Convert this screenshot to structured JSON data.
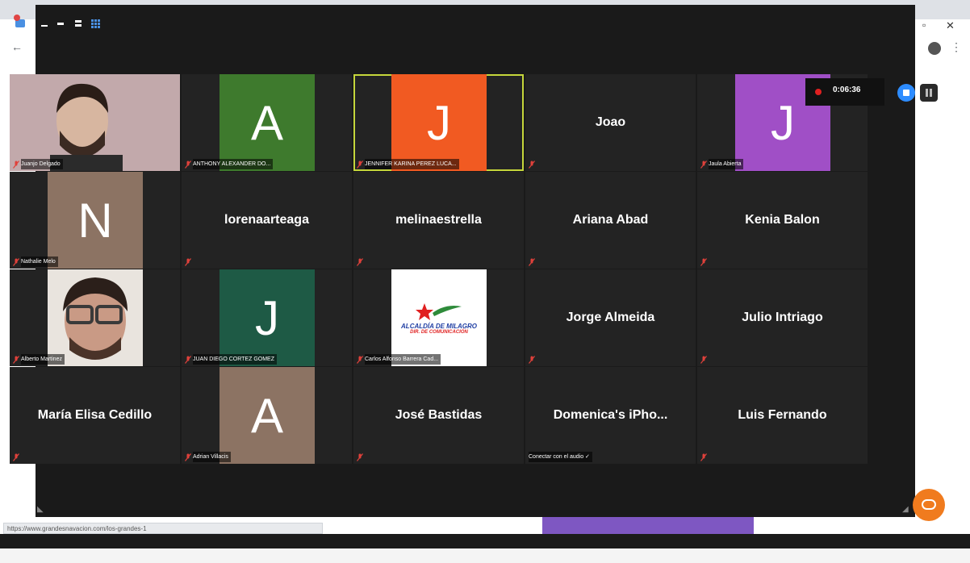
{
  "browser": {
    "back_glyph": "←",
    "menu_glyph": "⋮",
    "status_url": "https://www.grandesnavacion.com/los-grandes-1"
  },
  "window_controls": {
    "minimize": "▬",
    "restore": "▫",
    "close": "✕"
  },
  "toolbar": {
    "view_icons": [
      "minimize-icon",
      "minus-icon",
      "speaker-view-icon",
      "gallery-view-icon"
    ]
  },
  "recording": {
    "timer": "0:06:36"
  },
  "participants": [
    {
      "name": "Juanjo Delgado",
      "type": "video"
    },
    {
      "name": "ANTHONY ALEXANDER DO...",
      "type": "initial",
      "initial": "A",
      "color": "#3e7a2d"
    },
    {
      "name": "JENNIFER KARINA PEREZ LUCA...",
      "type": "initial",
      "initial": "J",
      "color": "#f15a22",
      "active": true
    },
    {
      "name": "Joao",
      "type": "text"
    },
    {
      "name": "Jaula Abierta",
      "type": "initial",
      "initial": "J",
      "color": "#a04fc6"
    },
    {
      "name": "Nathalie Melo",
      "type": "initial",
      "initial": "N",
      "color": "#8c7363"
    },
    {
      "name": "lorenaarteaga",
      "type": "text"
    },
    {
      "name": "melinaestrella",
      "type": "text"
    },
    {
      "name": "Ariana Abad",
      "type": "text"
    },
    {
      "name": "Kenia Balon",
      "type": "text"
    },
    {
      "name": "Alberto Martinez",
      "type": "video"
    },
    {
      "name": "JUAN DIEGO CORTEZ GOMEZ",
      "type": "initial",
      "initial": "J",
      "color": "#1e5a45"
    },
    {
      "name": "Carlos Alfonso Barrera Cad...",
      "type": "logo",
      "logo_line1": "ALCALDÍA DE MILAGRO",
      "logo_line2": "DIR. DE COMUNICACIÓN"
    },
    {
      "name": "Jorge Almeida",
      "type": "text"
    },
    {
      "name": "Julio Intriago",
      "type": "text"
    },
    {
      "name": "María Elisa Cedillo",
      "type": "text"
    },
    {
      "name": "Adrian Villacis",
      "type": "initial",
      "initial": "A",
      "color": "#8c7363"
    },
    {
      "name": "José Bastidas",
      "type": "text"
    },
    {
      "name": "Domenica's iPho...",
      "type": "text",
      "sub_label": "Conectar con el audio"
    },
    {
      "name": "Luis Fernando",
      "type": "text"
    }
  ]
}
